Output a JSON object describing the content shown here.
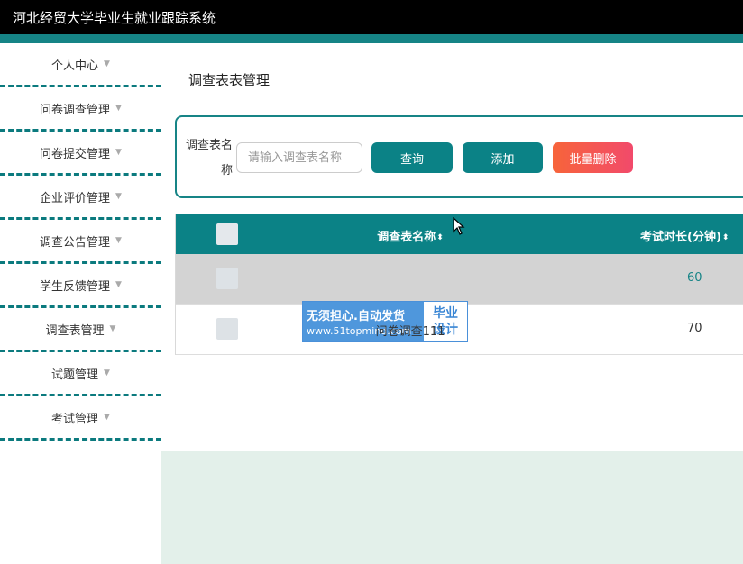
{
  "app": {
    "title": "河北经贸大学毕业生就业跟踪系统"
  },
  "sidebar": {
    "items": [
      {
        "label": "个人中心"
      },
      {
        "label": "问卷调查管理"
      },
      {
        "label": "问卷提交管理"
      },
      {
        "label": "企业评价管理"
      },
      {
        "label": "调查公告管理"
      },
      {
        "label": "学生反馈管理"
      },
      {
        "label": "调查表管理"
      },
      {
        "label": "试题管理"
      },
      {
        "label": "考试管理"
      }
    ],
    "caret_glyph": "▼"
  },
  "page": {
    "title": "调查表表管理"
  },
  "search": {
    "label_line1": "调查表名",
    "label_line2": "称",
    "placeholder": "请输入调查表名称",
    "search_button": "查询",
    "add_button": "添加",
    "batch_delete_button": "批量删除"
  },
  "table": {
    "columns": [
      {
        "label": "调查表名称"
      },
      {
        "label": "考试时长(分钟)"
      }
    ],
    "sort_glyph": "⬍",
    "rows": [
      {
        "name": "",
        "duration": "60",
        "highlighted": true
      },
      {
        "name": "问卷调查111",
        "duration": "70",
        "highlighted": false
      }
    ]
  },
  "watermark": {
    "line1": "无须担心.自动发货",
    "line2": "www.51topmind.com",
    "right1": "毕业",
    "right2": "设计"
  },
  "colors": {
    "topbar": "#000000",
    "accent": "#168486",
    "button": "#0b8286",
    "danger_start": "#f7643a",
    "danger_end": "#f24a6b",
    "content_bg": "#e3f0ea",
    "highlight_row": "#d3d3d3"
  }
}
